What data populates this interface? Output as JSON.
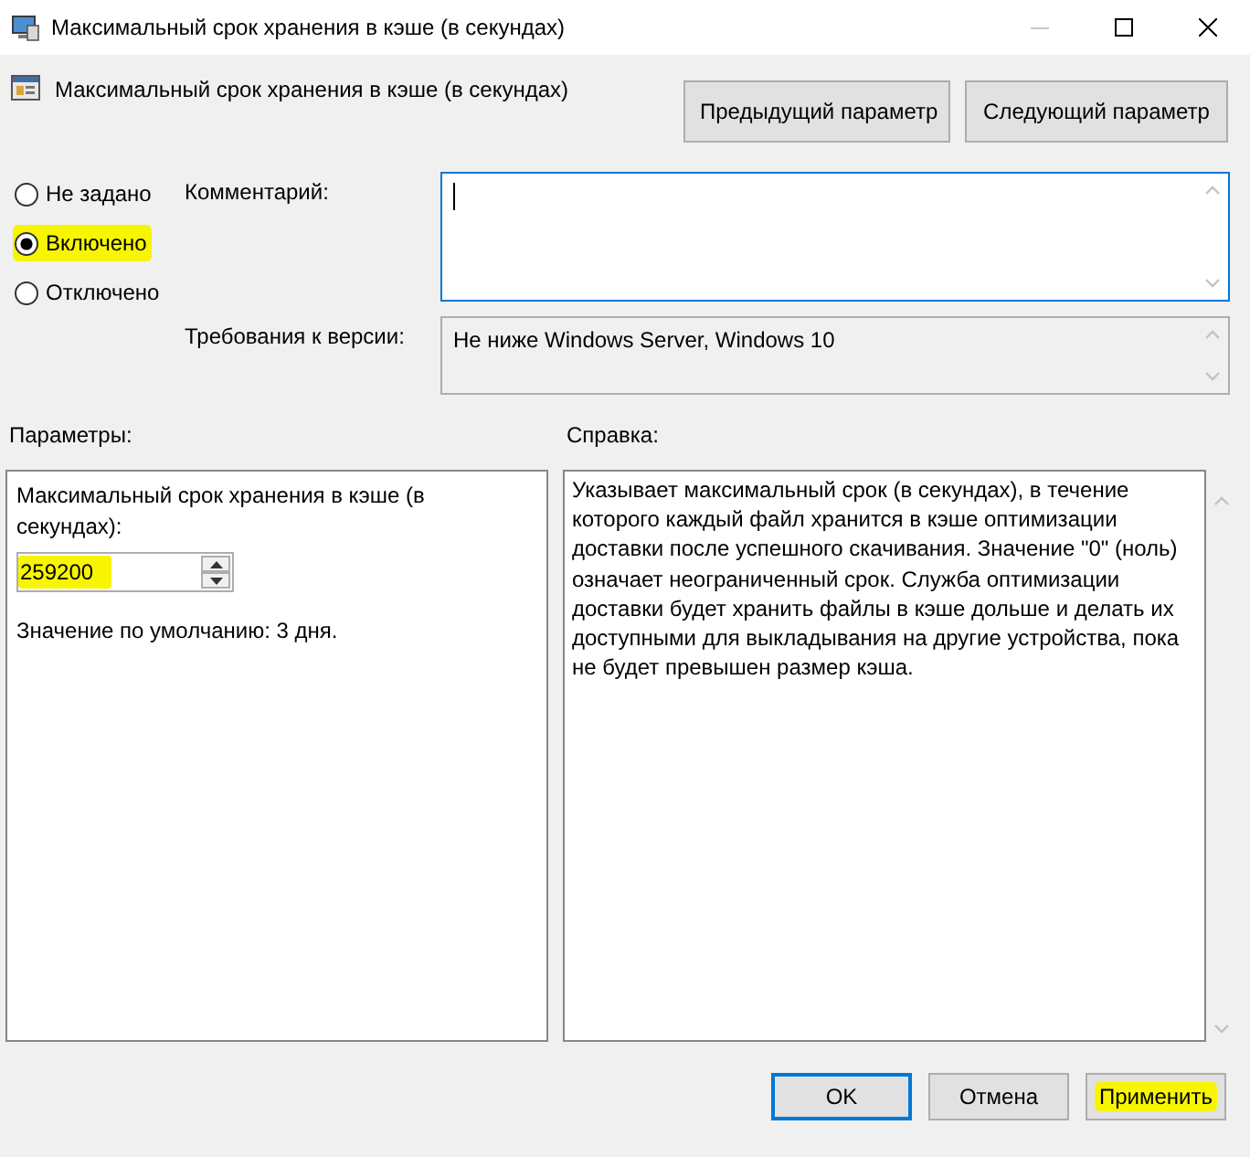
{
  "window": {
    "title": "Максимальный срок хранения в кэше (в секундах)"
  },
  "header": {
    "policy_name": "Максимальный срок хранения в кэше (в секундах)",
    "nav_buttons": [
      "Предыдущий параметр",
      "Следующий параметр"
    ]
  },
  "state_options": [
    {
      "label": "Не задано",
      "selected": false,
      "highlighted": false
    },
    {
      "label": "Включено",
      "selected": true,
      "highlighted": true
    },
    {
      "label": "Отключено",
      "selected": false,
      "highlighted": false
    }
  ],
  "comment": {
    "label": "Комментарий:",
    "focused": true
  },
  "version_requirements": {
    "label": "Требования к версии:",
    "value": "Не ниже Windows Server, Windows 10"
  },
  "options_panel": {
    "heading": "Параметры:",
    "setting_label": "Максимальный срок хранения в кэше (в секундах):",
    "value": "259200",
    "value_highlighted": true,
    "default_note": "Значение по умолчанию: 3 дня."
  },
  "help_panel": {
    "heading": "Справка:",
    "text": "Указывает максимальный срок (в секундах), в течение которого каждый файл хранится в кэше оптимизации доставки после успешного скачивания. Значение \"0\" (ноль) означает неограниченный срок. Служба оптимизации доставки будет хранить файлы в кэше дольше и делать их доступными для выкладывания на другие устройства, пока не будет превышен размер кэша."
  },
  "buttons": [
    {
      "label": "OK",
      "default": true,
      "highlighted": false
    },
    {
      "label": "Отмена",
      "default": false,
      "highlighted": false
    },
    {
      "label": "Применить",
      "default": false,
      "highlighted": true
    }
  ]
}
